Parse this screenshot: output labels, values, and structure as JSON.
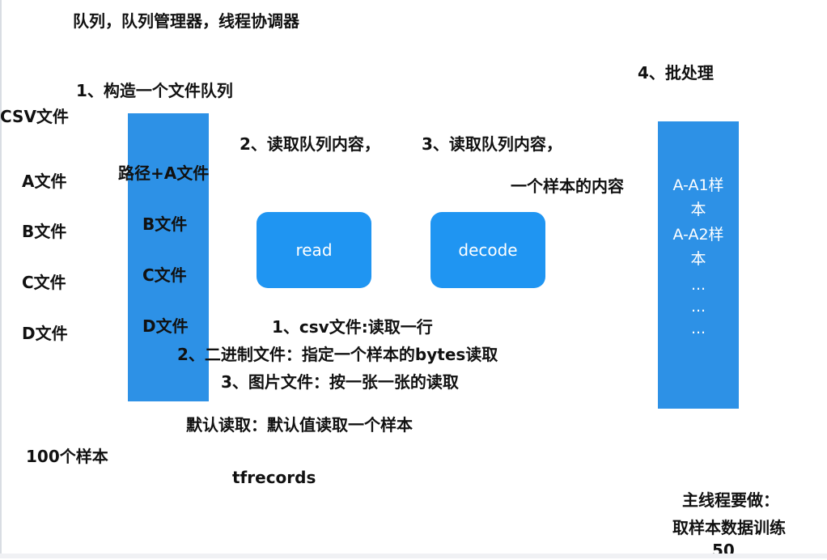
{
  "title": "队列，队列管理器，线程协调器",
  "steps": {
    "step1": "1、构造一个文件队列",
    "step2": "2、读取队列内容，",
    "step3": "3、读取队列内容，",
    "step4": "4、批处理"
  },
  "csv_label": "CSV文件",
  "files_left": [
    "A文件",
    "B文件",
    "C文件",
    "D文件"
  ],
  "queue_items": [
    "路径+A文件",
    "B文件",
    "C文件",
    "D文件"
  ],
  "ops": {
    "read": "read",
    "decode": "decode"
  },
  "sample_note": "一个样本的内容",
  "batch_items": [
    "A-A1样",
    "本",
    "A-A2样",
    "本",
    "...",
    "...",
    "..."
  ],
  "read_notes": [
    "1、csv文件:读取一行",
    "2、二进制文件：指定一个样本的bytes读取",
    "3、图片文件：按一张一张的读取"
  ],
  "default_read": "默认读取：默认值读取一个样本",
  "samples_count": "100个样本",
  "tfrecords": "tfrecords",
  "main_thread": [
    "主线程要做：",
    "取样本数据训练",
    "50"
  ],
  "colors": {
    "block_blue": "#2d91e6",
    "button_blue": "#1f95f2",
    "text": "#111111"
  }
}
